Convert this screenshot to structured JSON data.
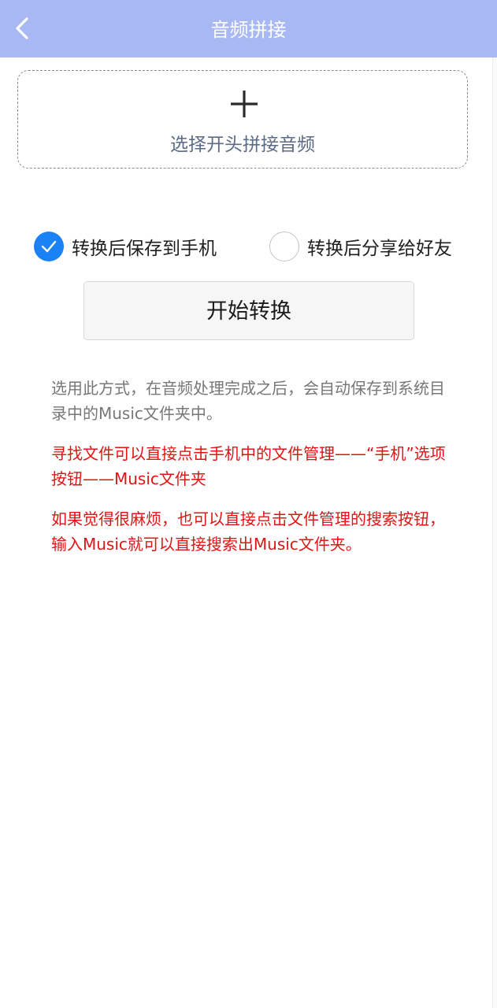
{
  "header": {
    "title": "音频拼接",
    "back_icon": "chevron-left-icon"
  },
  "upload": {
    "icon": "plus-icon",
    "label": "选择开头拼接音频"
  },
  "options": [
    {
      "label": "转换后保存到手机",
      "checked": true
    },
    {
      "label": "转换后分享给好友",
      "checked": false
    }
  ],
  "start_button": {
    "label": "开始转换"
  },
  "info": {
    "description": "选用此方式，在音频处理完成之后，会自动保存到系统目录中的Music文件夹中。",
    "tip_find": "寻找文件可以直接点击手机中的文件管理——“手机”选项按钮——Music文件夹",
    "tip_search": "如果觉得很麻烦，也可以直接点击文件管理的搜索按钮，输入Music就可以直接搜索出Music文件夹。"
  },
  "colors": {
    "header_bg": "#a8b8f2",
    "accent": "#1a82f5",
    "warning_text": "#e01414"
  }
}
